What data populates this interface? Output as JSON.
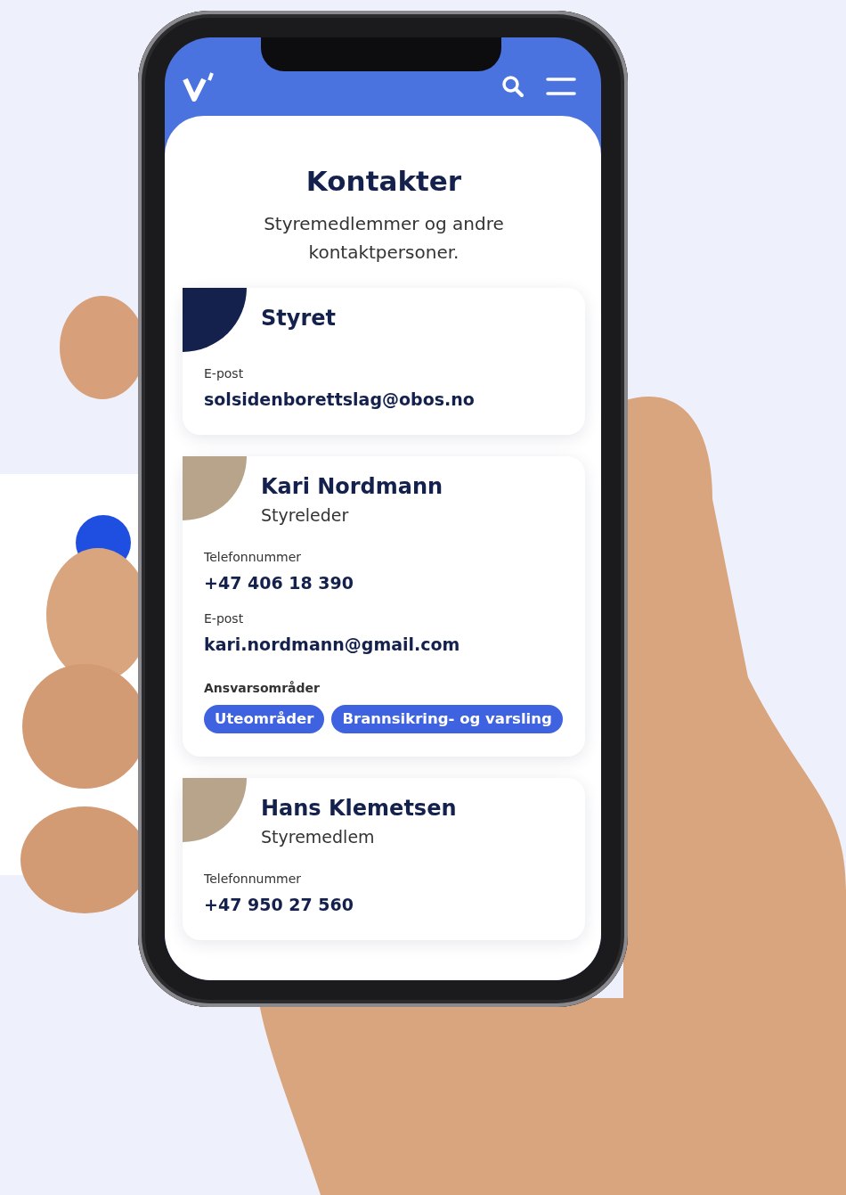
{
  "page": {
    "title": "Kontakter",
    "subtitle": "Styremedlemmer og andre kontaktpersoner."
  },
  "contacts": [
    {
      "kind": "group",
      "name": "Styret",
      "fields": [
        {
          "label": "E-post",
          "value": "solsidenborettslag@obos.no"
        }
      ]
    },
    {
      "kind": "person",
      "name": "Kari Nordmann",
      "role": "Styreleder",
      "fields": [
        {
          "label": "Telefonnummer",
          "value": "+47 406 18 390"
        },
        {
          "label": "E-post",
          "value": "kari.nordmann@gmail.com"
        }
      ],
      "areas_label": "Ansvarsområder",
      "areas": [
        "Uteområder",
        "Brannsikring- og varsling"
      ]
    },
    {
      "kind": "person",
      "name": "Hans Klemetsen",
      "role": "Styremedlem",
      "fields": [
        {
          "label": "Telefonnummer",
          "value": "+47 950 27 560"
        }
      ]
    }
  ]
}
